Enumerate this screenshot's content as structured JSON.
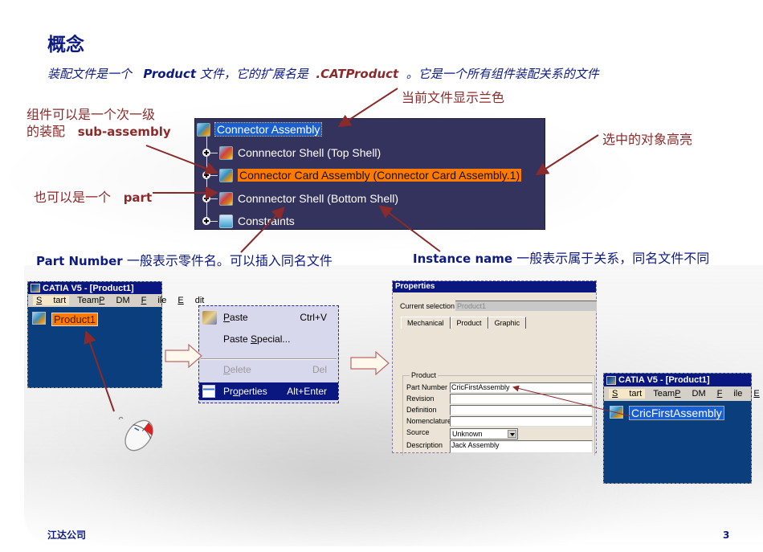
{
  "slide": {
    "title": "概念",
    "subtitle": {
      "part1": "装配文件是一个",
      "product": "Product",
      "part2": "文件，它的扩展名是",
      "ext": ".CATProduct",
      "part3": "。它是一个所有组件装配关系的文件"
    },
    "annotations": {
      "current_file_blue": "当前文件显示兰色",
      "sub_assembly_line1": "组件可以是一个次一级",
      "sub_assembly_line2_cn": "的装配",
      "sub_assembly_line2_en": "sub-assembly",
      "selected_highlight": "选中的对象高亮",
      "also_part_cn": "也可以是一个",
      "also_part_en": "part",
      "part_number_en": "Part Number",
      "part_number_cn": "一般表示零件名。可以插入同名文件",
      "instance_name_en": "Instance name",
      "instance_name_cn": "一般表示属于关系，同名文件不同"
    },
    "footer": {
      "company": "江达公司",
      "page_number": "3"
    }
  },
  "tree": {
    "root": {
      "label": "Connector Assembly",
      "icon": "product-icon"
    },
    "children": [
      {
        "label": "Connnector Shell (Top Shell)",
        "icon": "part-icon",
        "selected": false
      },
      {
        "label": "Connector Card Assembly (Connector Card Assembly.1)",
        "icon": "product-icon",
        "selected": true
      },
      {
        "label": "Connnector Shell (Bottom Shell)",
        "icon": "part-icon",
        "selected": false
      },
      {
        "label": "Constraints",
        "icon": "constraints-icon",
        "selected": false
      }
    ]
  },
  "catia_window_before": {
    "title": "CATIA V5 - [Product1]",
    "menu": [
      "Start",
      "TeamPDM",
      "File",
      "Edit"
    ],
    "node_label": "Product1"
  },
  "context_menu": {
    "items": [
      {
        "label": "Paste",
        "shortcut": "Ctrl+V",
        "icon": "paste-icon",
        "disabled": false,
        "active": false
      },
      {
        "label": "Paste Special...",
        "shortcut": "",
        "disabled": false,
        "active": false
      },
      {
        "label": "Delete",
        "shortcut": "Del",
        "disabled": true,
        "active": false
      },
      {
        "label": "Properties",
        "shortcut": "Alt+Enter",
        "icon": "properties-icon",
        "disabled": false,
        "active": true
      }
    ]
  },
  "properties_dialog": {
    "title": "Properties",
    "current_selection_label": "Current selection :",
    "current_selection_value": "Product1",
    "tabs": [
      "Mechanical",
      "Product",
      "Graphic"
    ],
    "active_tab": "Product",
    "group_title": "Product",
    "fields": [
      {
        "label": "Part Number",
        "value": "CricFirstAssembly"
      },
      {
        "label": "Revision",
        "value": ""
      },
      {
        "label": "Definition",
        "value": ""
      },
      {
        "label": "Nomenclature",
        "value": ""
      },
      {
        "label": "Source",
        "value": "Unknown",
        "type": "select"
      },
      {
        "label": "Description",
        "value": "Jack Assembly"
      }
    ]
  },
  "catia_window_after": {
    "title": "CATIA V5 - [Product1]",
    "menu": [
      "Start",
      "TeamPDM",
      "File",
      "Edit"
    ],
    "node_label": "CricFirstAssembly"
  },
  "colors": {
    "title_blue": "#0d1a80",
    "annotation_red": "#8b2a2a",
    "tree_bg": "#33335e",
    "highlight_orange": "#ff7a00",
    "current_blue": "#1a5fd0",
    "catia_bg": "#0b3e7d"
  }
}
